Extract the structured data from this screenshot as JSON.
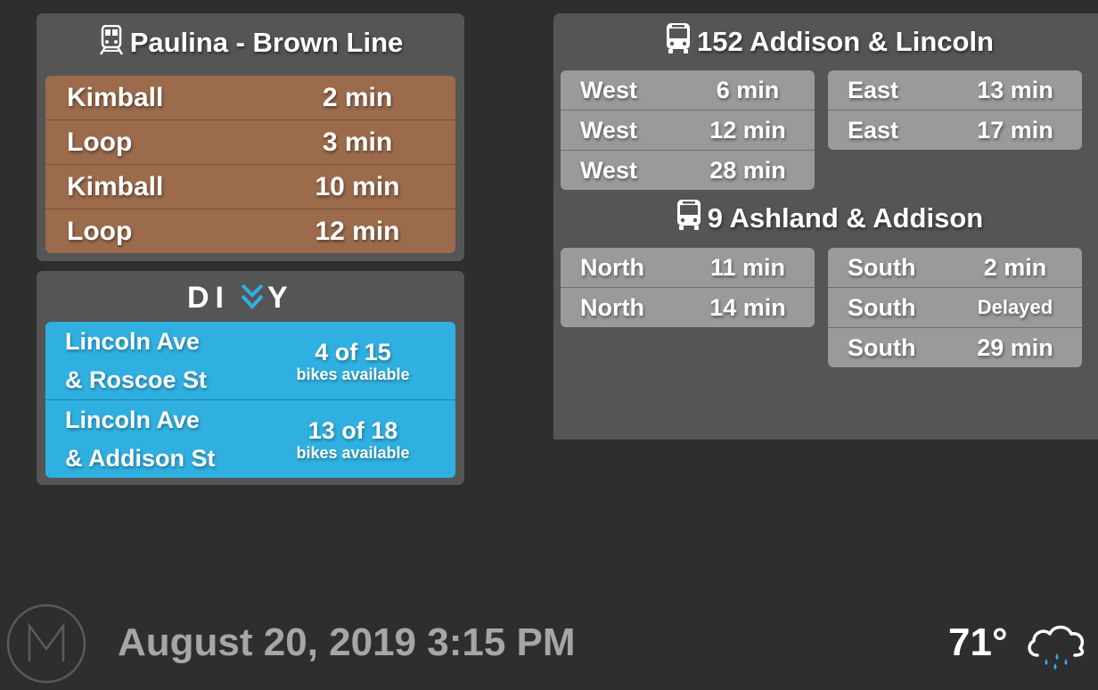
{
  "train": {
    "title": "Paulina - Brown Line",
    "icon": "train-icon",
    "color": "#9b6b4c",
    "arrivals": [
      {
        "destination": "Kimball",
        "time": "2 min"
      },
      {
        "destination": "Loop",
        "time": "3 min"
      },
      {
        "destination": "Kimball",
        "time": "10 min"
      },
      {
        "destination": "Loop",
        "time": "12 min"
      }
    ]
  },
  "divvy": {
    "logo": "DIVVY",
    "color": "#2fb0e0",
    "stations": [
      {
        "name_line1": "Lincoln Ave",
        "name_line2": "& Roscoe St",
        "count": "4 of 15",
        "label": "bikes available"
      },
      {
        "name_line1": "Lincoln Ave",
        "name_line2": "& Addison St",
        "count": "13 of 18",
        "label": "bikes available"
      }
    ]
  },
  "bus": {
    "icon": "bus-icon",
    "routes": [
      {
        "title": "152 Addison & Lincoln",
        "left": [
          {
            "direction": "West",
            "time": "6 min"
          },
          {
            "direction": "West",
            "time": "12 min"
          },
          {
            "direction": "West",
            "time": "28 min"
          }
        ],
        "right": [
          {
            "direction": "East",
            "time": "13 min"
          },
          {
            "direction": "East",
            "time": "17 min"
          }
        ]
      },
      {
        "title": "9 Ashland & Addison",
        "left": [
          {
            "direction": "North",
            "time": "11 min"
          },
          {
            "direction": "North",
            "time": "14 min"
          }
        ],
        "right": [
          {
            "direction": "South",
            "time": "2 min"
          },
          {
            "direction": "South",
            "time": "Delayed"
          },
          {
            "direction": "South",
            "time": "29 min"
          }
        ]
      }
    ]
  },
  "footer": {
    "logo": "M",
    "datetime": "August 20, 2019 3:15 PM",
    "temperature": "71°",
    "weather_icon": "rain-cloud-icon"
  }
}
